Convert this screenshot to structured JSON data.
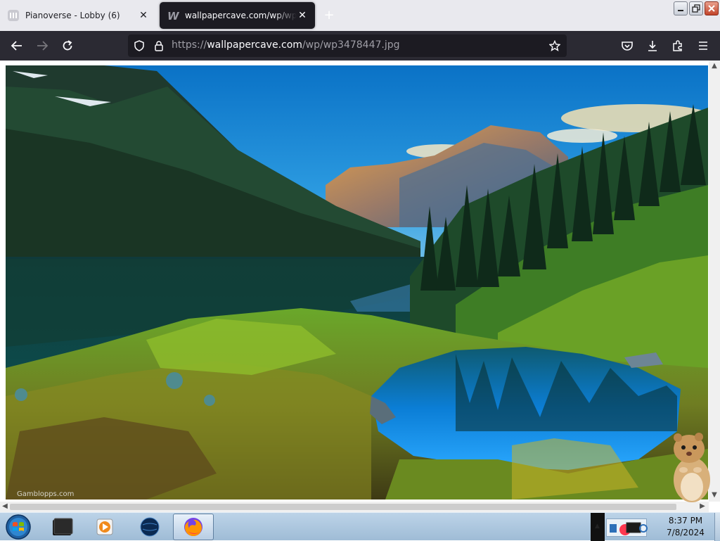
{
  "browser": {
    "tabs": [
      {
        "title": "Pianoverse - Lobby (6)",
        "icon": "pianoverse-icon",
        "active": false
      },
      {
        "title": "wallpapercave.com/wp/wp3478447.jpg",
        "icon": "wallpapercave-icon",
        "active": true
      }
    ],
    "new_tab_icon": "plus-icon",
    "window_controls": [
      "minimize-icon",
      "restore-icon",
      "close-icon"
    ]
  },
  "navbar": {
    "back_icon": "back-arrow-icon",
    "forward_icon": "forward-arrow-icon",
    "reload_icon": "reload-icon",
    "url_scheme": "https://",
    "url_host": "wallpapercave.com",
    "url_path": "/wp/wp3478447.jpg",
    "toolbar_icons": [
      "pocket-icon",
      "downloads-icon",
      "extensions-icon",
      "menu-icon"
    ]
  },
  "content": {
    "image_subject": "mountain lake landscape wallpaper",
    "watermark": "Gamblopps.com"
  },
  "taskbar": {
    "items": [
      "start-orb-icon",
      "terminal-icon",
      "media-player-icon",
      "network-globe-icon",
      "firefox-icon"
    ],
    "time": "8:37 PM",
    "date": "7/8/2024"
  },
  "colors": {
    "tabstrip_bg": "#e9e9ee",
    "navbar_bg": "#2b2a33",
    "urlbar_bg": "#1c1b22",
    "taskbar_top": "#bcd3e8",
    "taskbar_bottom": "#9fbcd6"
  }
}
